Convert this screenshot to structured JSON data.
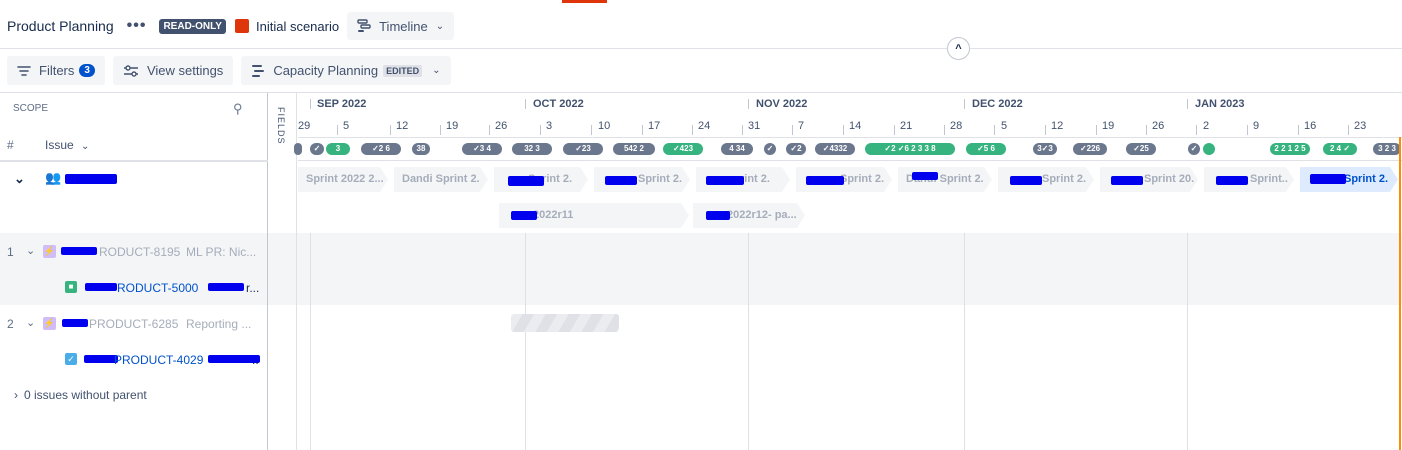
{
  "header": {
    "title": "Product Planning",
    "more_label": "•••",
    "readonly_badge": "READ-ONLY",
    "scenario_color": "#de350b",
    "scenario_name": "Initial scenario",
    "view_label": "Timeline",
    "view_icon": "timeline-icon"
  },
  "toolbar": {
    "filters_label": "Filters",
    "filters_count": "3",
    "view_settings_label": "View settings",
    "capacity_label": "Capacity Planning",
    "capacity_badge": "EDITED"
  },
  "scope": {
    "label": "SCOPE",
    "hash": "#",
    "issue_col": "Issue",
    "fields_label": "FIELDS",
    "rows": [
      {
        "num": "1",
        "key": "RODUCT-8195",
        "summary": "ML PR: Nic...",
        "type": "epic"
      },
      {
        "num": "",
        "key": "RODUCT-5000",
        "summary": "r...",
        "type": "story"
      },
      {
        "num": "2",
        "key": "PRODUCT-6285",
        "summary": "Reporting ...",
        "type": "epic"
      },
      {
        "num": "",
        "key": "PRODUCT-4029",
        "summary": "",
        "type": "task"
      }
    ],
    "without_parent": "0 issues without parent"
  },
  "timeline": {
    "months": [
      "SEP 2022",
      "OCT 2022",
      "NOV 2022",
      "DEC 2022",
      "JAN 2023"
    ],
    "weeks": [
      "29",
      "5",
      "12",
      "19",
      "26",
      "3",
      "10",
      "17",
      "24",
      "31",
      "7",
      "14",
      "21",
      "28",
      "5",
      "12",
      "19",
      "26",
      "2",
      "9",
      "16",
      "23"
    ],
    "sprints": [
      "Sprint 2022 2...",
      "Dandi Sprint 2.",
      "Sprint 2.",
      "Sprint 2.",
      "rint 2.",
      "Sprint 2.",
      "Dandi Sprint 2.",
      "Sprint 2.",
      "Sprint 20.",
      "Sprint..",
      "Sprint 2."
    ],
    "releases": [
      "2022r11",
      "2022r12- pa..."
    ]
  }
}
